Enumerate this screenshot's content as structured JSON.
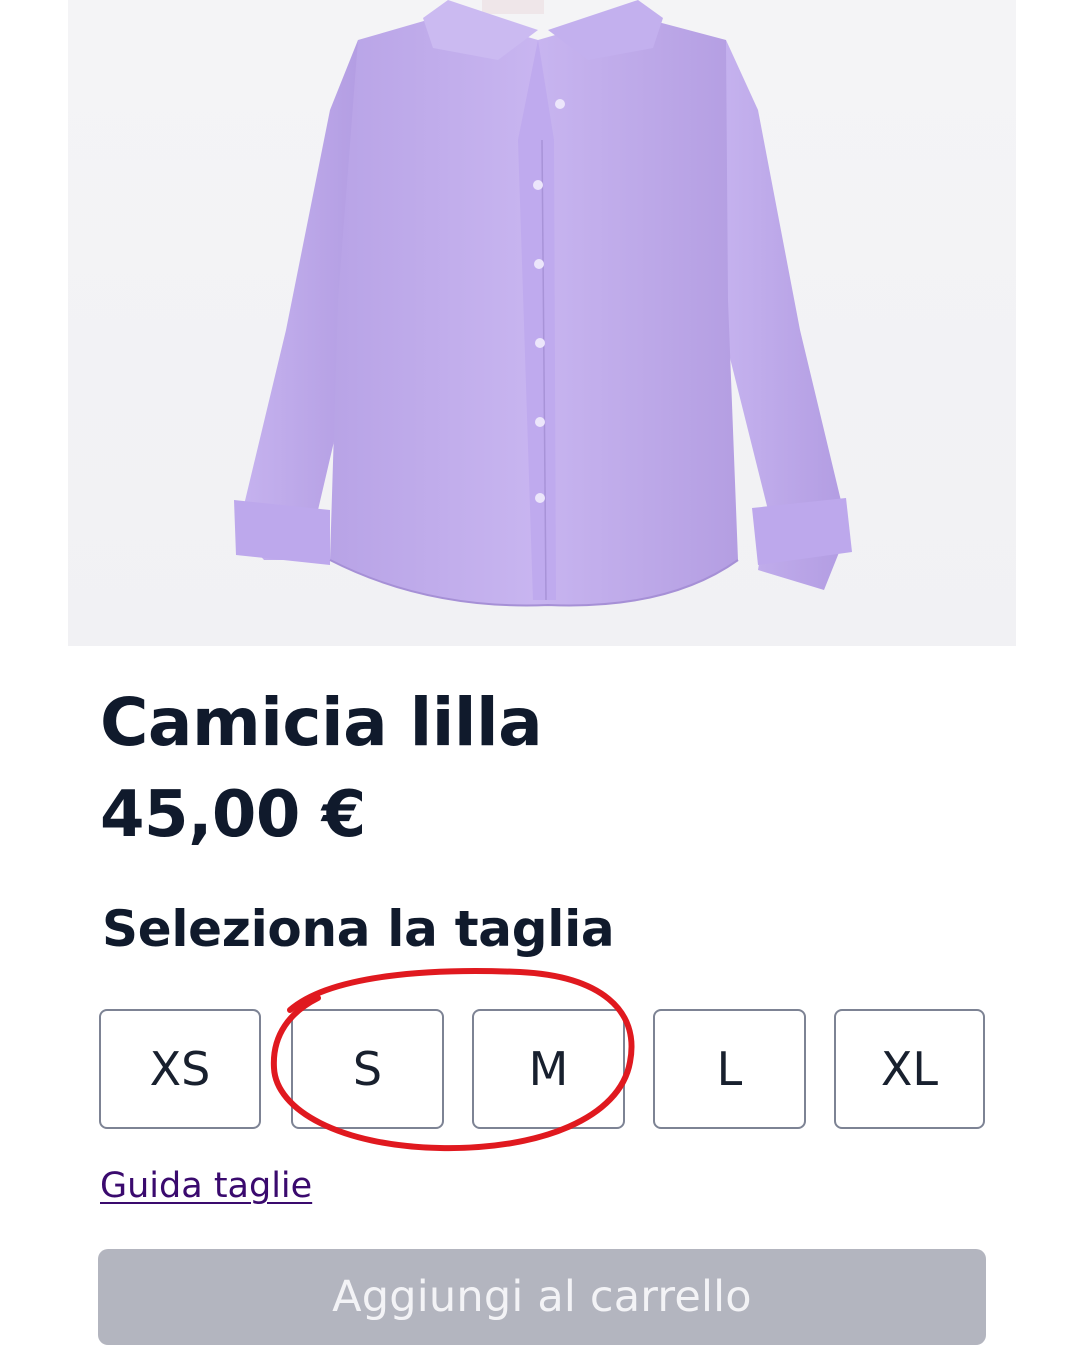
{
  "product": {
    "name": "Camicia lilla",
    "price": "45,00 €",
    "image_icon": "lilac-shirt-image"
  },
  "size_selector": {
    "heading": "Seleziona la taglia",
    "sizes": [
      "XS",
      "S",
      "M",
      "L",
      "XL"
    ],
    "annotation": "red-circle-highlighting-S-and-M"
  },
  "links": {
    "size_guide": "Guida taglie"
  },
  "cart": {
    "add_label": "Aggiungi al carrello",
    "enabled": false
  },
  "colors": {
    "text": "#101a2c",
    "shirt": "#c3aeee",
    "link": "#3a0a6e",
    "button_disabled": "#b3b5bf",
    "annotation": "#e0191f"
  }
}
